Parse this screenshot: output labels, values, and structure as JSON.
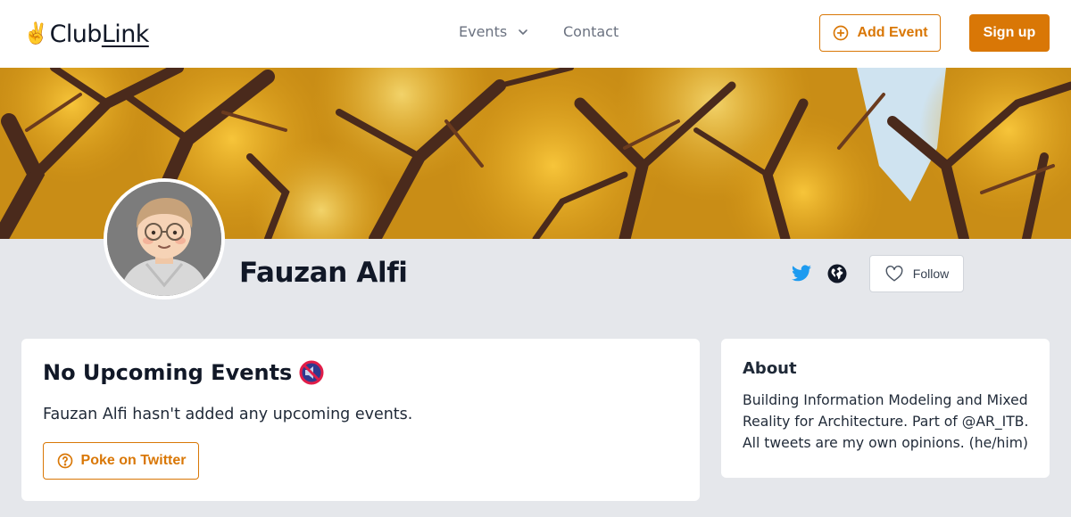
{
  "brand": {
    "emoji": "✌️",
    "name_part1": "Club",
    "name_part2": "Link"
  },
  "nav": {
    "events_label": "Events",
    "contact_label": "Contact",
    "add_event_label": "Add Event",
    "signup_label": "Sign up"
  },
  "profile": {
    "name": "Fauzan Alfi",
    "follow_label": "Follow"
  },
  "events_card": {
    "title": "No Upcoming Events",
    "message": "Fauzan Alfi hasn't added any upcoming events.",
    "poke_label": "Poke on Twitter"
  },
  "about_card": {
    "title": "About",
    "bio": "Building Information Modeling and Mixed Reality for Architecture. Part of @AR_ITB. All tweets are my own opinions. (he/him)"
  },
  "colors": {
    "accent": "#d97706",
    "page_bg": "#e5e7eb",
    "twitter_blue": "#1d9bf0"
  },
  "icons": {
    "events_chevron": "chevron-down-icon",
    "add_event": "plus-circle-icon",
    "twitter": "twitter-icon",
    "website": "globe-icon",
    "follow": "heart-icon",
    "no_events": "muted-speaker-icon",
    "poke": "question-circle-icon"
  }
}
